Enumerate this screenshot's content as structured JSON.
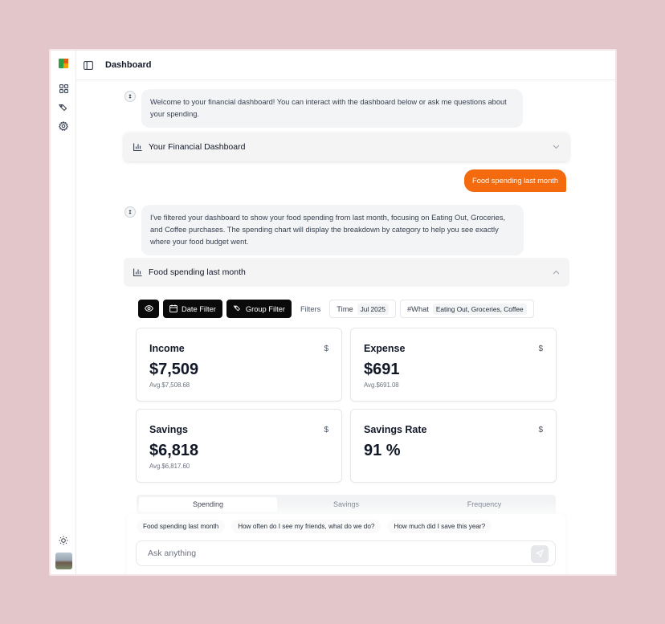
{
  "header": {
    "title": "Dashboard"
  },
  "rail": {
    "icons": [
      "grid-icon",
      "tag-icon",
      "gear-icon",
      "sun-icon"
    ]
  },
  "messages": {
    "welcome": "Welcome to your financial dashboard! You can interact with the dashboard below or ask me questions about your spending.",
    "user": "Food spending last month",
    "reply": "I've filtered your dashboard to show your food spending from last month, focusing on Eating Out, Groceries, and Coffee purchases. The spending chart will display the breakdown by category to help you see exactly where your food budget went."
  },
  "dashboard_card": {
    "title": "Your Financial Dashboard"
  },
  "food_card": {
    "title": "Food spending last month",
    "toolbar": {
      "date_filter": "Date Filter",
      "group_filter": "Group Filter",
      "filters_label": "Filters",
      "time_label": "Time",
      "time_value": "Jul 2025",
      "what_label": "#What",
      "what_value": "Eating Out, Groceries, Coffee"
    },
    "stats": [
      {
        "label": "Income",
        "currency": "$",
        "value": "$7,509",
        "avg": "Avg.$7,508.68"
      },
      {
        "label": "Expense",
        "currency": "$",
        "value": "$691",
        "avg": "Avg.$691.08"
      },
      {
        "label": "Savings",
        "currency": "$",
        "value": "$6,818",
        "avg": "Avg.$6,817.60"
      },
      {
        "label": "Savings Rate",
        "currency": "$",
        "value": "91 %",
        "avg": ""
      }
    ],
    "tabs": [
      "Spending",
      "Savings",
      "Frequency"
    ]
  },
  "composer": {
    "suggestions": [
      "Food spending last month",
      "How often do I see my friends, what do we do?",
      "How much did I save this year?"
    ],
    "placeholder": "Ask anything"
  },
  "colors": {
    "accent": "#f46a0f",
    "background": "#e2c6ca"
  }
}
